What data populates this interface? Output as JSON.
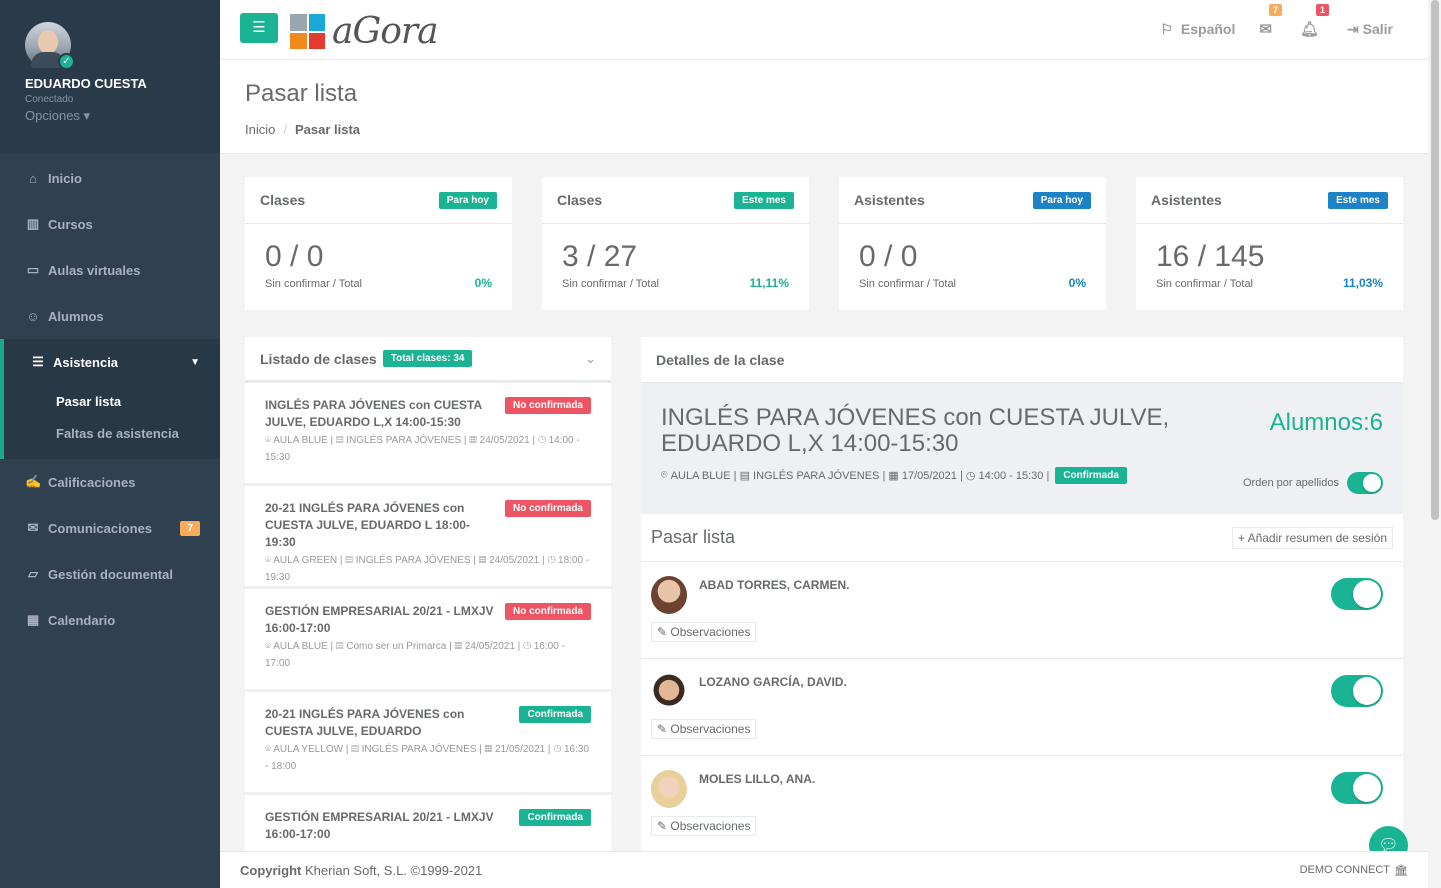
{
  "user": {
    "name": "EDUARDO CUESTA",
    "status": "Conectado",
    "options": "Opciones"
  },
  "nav": {
    "inicio": "Inicio",
    "cursos": "Cursos",
    "aulas": "Aulas virtuales",
    "alumnos": "Alumnos",
    "asistencia": "Asistencia",
    "pasar_lista": "Pasar lista",
    "faltas": "Faltas de asistencia",
    "calificaciones": "Calificaciones",
    "comunicaciones": "Comunicaciones",
    "comunicaciones_badge": "7",
    "gestion": "Gestión documental",
    "calendario": "Calendario"
  },
  "topbar": {
    "logo_text": "aGora",
    "language": "Español",
    "mail_badge": "7",
    "bell_badge": "1",
    "logout": "Salir"
  },
  "heading": {
    "title": "Pasar lista",
    "breadcrumb_home": "Inicio",
    "breadcrumb_current": "Pasar lista"
  },
  "stats": [
    {
      "title": "Clases",
      "label": "Para hoy",
      "value": "0 / 0",
      "sub": "Sin confirmar / Total",
      "pct": "0%"
    },
    {
      "title": "Clases",
      "label": "Este mes",
      "value": "3 / 27",
      "sub": "Sin confirmar / Total",
      "pct": "11,11%"
    },
    {
      "title": "Asistentes",
      "label": "Para hoy",
      "value": "0 / 0",
      "sub": "Sin confirmar / Total",
      "pct": "0%"
    },
    {
      "title": "Asistentes",
      "label": "Este mes",
      "value": "16 / 145",
      "sub": "Sin confirmar / Total",
      "pct": "11,03%"
    }
  ],
  "class_list": {
    "title": "Listado de clases",
    "total_label": "Total clases: 34",
    "items": [
      {
        "title": "INGLÉS PARA JÓVENES con CUESTA JULVE, EDUARDO L,X 14:00-15:30",
        "status": "No confirmada",
        "room": "AULA BLUE",
        "course": "INGLÉS PARA JÓVENES",
        "date": "24/05/2021",
        "time": "14:00 - 15:30"
      },
      {
        "title": "20-21 INGLÉS PARA JÓVENES con CUESTA JULVE, EDUARDO L 18:00-19:30",
        "status": "No confirmada",
        "room": "AULA GREEN",
        "course": "INGLÉS PARA JÓVENES",
        "date": "24/05/2021",
        "time": "18:00 - 19:30"
      },
      {
        "title": "GESTIÓN EMPRESARIAL 20/21 - LMXJV 16:00-17:00",
        "status": "No confirmada",
        "room": "AULA BLUE",
        "course": "Como ser un Primarca",
        "date": "24/05/2021",
        "time": "16:00 - 17:00"
      },
      {
        "title": "20-21 INGLÉS PARA JÓVENES con CUESTA JULVE, EDUARDO",
        "status": "Confirmada",
        "room": "AULA YELLOW",
        "course": "INGLÉS PARA JÓVENES",
        "date": "21/05/2021",
        "time": "16:30 - 18:00"
      },
      {
        "title": "GESTIÓN EMPRESARIAL 20/21 - LMXJV 16:00-17:00",
        "status": "Confirmada",
        "room": "",
        "course": "",
        "date": "",
        "time": ""
      }
    ]
  },
  "detail": {
    "header": "Detalles de la clase",
    "title": "INGLÉS PARA JÓVENES con CUESTA JULVE, EDUARDO L,X 14:00-15:30",
    "alumnos": "Alumnos:6",
    "room": "AULA BLUE",
    "course": "INGLÉS PARA JÓVENES",
    "date": "17/05/2021",
    "time": "14:00 - 15:30",
    "status": "Confirmada",
    "order_label": "Orden por apellidos",
    "pasar_lista": "Pasar lista",
    "add_summary": "Añadir resumen de sesión",
    "observations": "Observaciones",
    "students": [
      {
        "name": "ABAD TORRES, CARMEN."
      },
      {
        "name": "LOZANO GARCÍA, DAVID."
      },
      {
        "name": "MOLES LILLO, ANA."
      }
    ]
  },
  "footer": {
    "copy_bold": "Copyright",
    "copy": "Kherian Soft, S.L. ©1999-2021",
    "demo": "DEMO CONNECT"
  },
  "colors": {
    "primary": "#1ab394",
    "blue": "#1c84c6",
    "red": "#ed5565",
    "orange": "#f8ac59",
    "sidebar": "#2f4050"
  }
}
